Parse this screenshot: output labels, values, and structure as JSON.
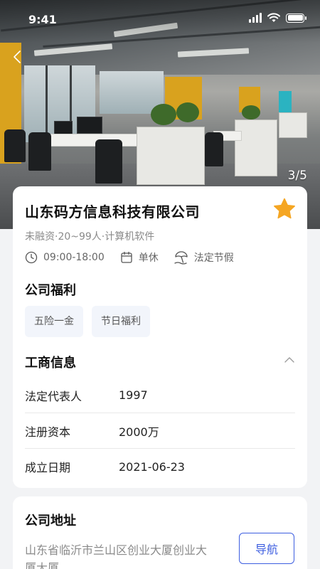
{
  "status_bar": {
    "time": "9:41"
  },
  "gallery": {
    "current": 3,
    "total": 5,
    "counter_text": "3/5"
  },
  "company": {
    "name": "山东码方信息科技有限公司",
    "meta": "未融资·20~99人·计算机软件",
    "favorited": true,
    "work_hours": "09:00-18:00",
    "rest": "单休",
    "holidays": "法定节假"
  },
  "benefits": {
    "title": "公司福利",
    "items": [
      "五险一金",
      "节日福利"
    ]
  },
  "business_info": {
    "title": "工商信息",
    "rows": [
      {
        "label": "法定代表人",
        "value": "1997"
      },
      {
        "label": "注册资本",
        "value": "2000万"
      },
      {
        "label": "成立日期",
        "value": "2021-06-23"
      }
    ]
  },
  "address": {
    "title": "公司地址",
    "text": "山东省临沂市兰山区创业大厦创业大厦大厦",
    "nav_label": "导航"
  },
  "colors": {
    "accent": "#3d5ee0",
    "star": "#f5a623",
    "tag_bg": "#f2f5fb"
  }
}
